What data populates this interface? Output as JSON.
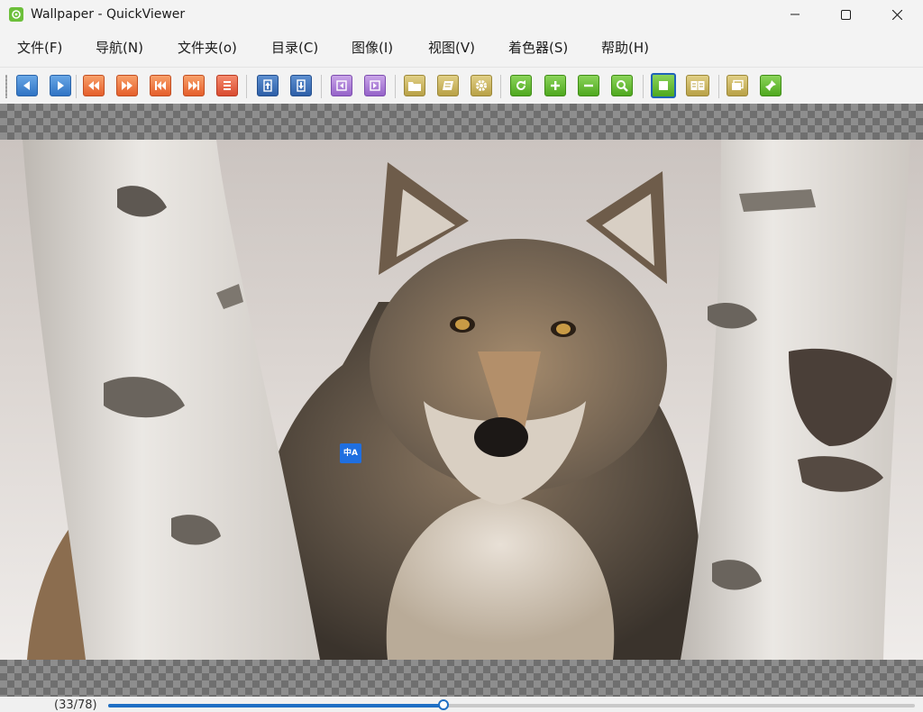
{
  "window": {
    "title": "Wallpaper - QuickViewer"
  },
  "menu": [
    {
      "label": "文件(F)"
    },
    {
      "label": "导航(N)"
    },
    {
      "label": "文件夹(o)"
    },
    {
      "label": "目录(C)"
    },
    {
      "label": "图像(I)"
    },
    {
      "label": "视图(V)"
    },
    {
      "label": "着色器(S)"
    },
    {
      "label": "帮助(H)"
    }
  ],
  "toolbar": {
    "buttons": [
      {
        "icon": "prev-page-icon"
      },
      {
        "icon": "next-page-icon"
      },
      {
        "icon": "fast-backward-icon"
      },
      {
        "icon": "fast-forward-icon"
      },
      {
        "icon": "first-page-icon"
      },
      {
        "icon": "last-page-icon"
      },
      {
        "icon": "page-list-icon"
      },
      {
        "icon": "prev-folder-icon"
      },
      {
        "icon": "next-folder-icon"
      },
      {
        "icon": "move-left-icon"
      },
      {
        "icon": "move-right-icon"
      },
      {
        "icon": "open-folder-icon"
      },
      {
        "icon": "catalog-icon"
      },
      {
        "icon": "settings-icon"
      },
      {
        "icon": "rotate-icon"
      },
      {
        "icon": "zoom-in-icon"
      },
      {
        "icon": "zoom-out-icon"
      },
      {
        "icon": "fit-icon"
      },
      {
        "icon": "single-page-icon"
      },
      {
        "icon": "dual-page-icon"
      },
      {
        "icon": "slideshow-icon"
      },
      {
        "icon": "pin-icon"
      }
    ],
    "active_view": "single-page-icon"
  },
  "viewer": {
    "translate_badge": "中A"
  },
  "status": {
    "page_counter": "(33/78)",
    "current_page": 33,
    "total_pages": 78
  },
  "colors": {
    "accent": "#1f6fc4",
    "titlebar_bg": "#f3f3f3",
    "checker_light": "#8e8e8e",
    "checker_dark": "#6f6f6f"
  }
}
